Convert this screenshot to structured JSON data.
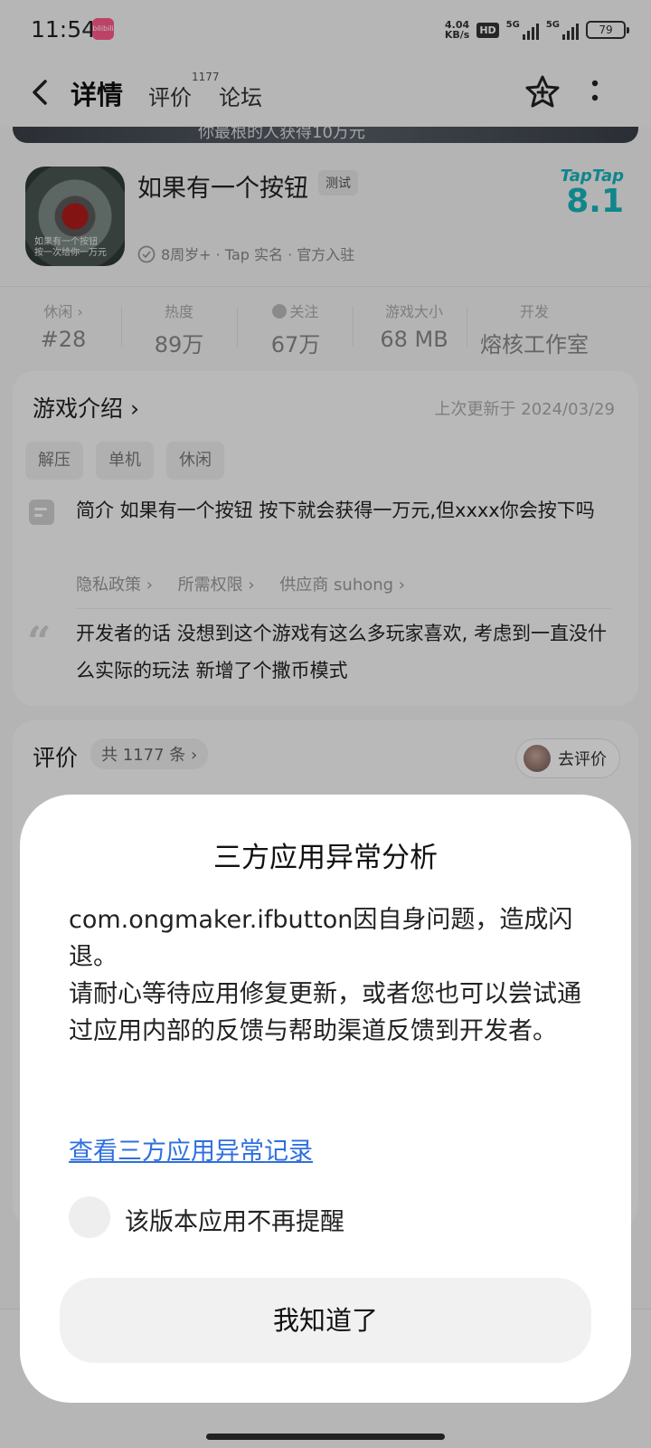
{
  "status_bar": {
    "time": "11:54",
    "app_badge": "bilibili",
    "net_speed_value": "4.04",
    "net_speed_unit": "KB/s",
    "hd": "HD",
    "signal1": "5G",
    "signal2": "5G",
    "battery": "79"
  },
  "header": {
    "tab_details": "详情",
    "tab_reviews": "评价",
    "review_count_sup": "1177",
    "tab_forum": "论坛"
  },
  "banner": {
    "text": "你最根的人获得10万元"
  },
  "game": {
    "title": "如果有一个按钮",
    "test_tag": "测试",
    "icon_caption_1": "如果有一个按钮",
    "icon_caption_2": "按一次给你一万元",
    "meta": "8周岁+ · Tap 实名 · 官方入驻",
    "score_brand": "TapTap",
    "score": "8.1"
  },
  "stats": [
    {
      "label": "休闲 ›",
      "value": "#28"
    },
    {
      "label": "热度",
      "value": "89万"
    },
    {
      "label": "关注",
      "value": "67万"
    },
    {
      "label": "游戏大小",
      "value": "68 MB"
    },
    {
      "label": "开发",
      "value": "熔核工作室"
    }
  ],
  "intro": {
    "title": "游戏介绍 ›",
    "updated": "上次更新于 2024/03/29",
    "tags": [
      "解压",
      "单机",
      "休闲"
    ],
    "summary": "简介 如果有一个按钮 按下就会获得一万元,但xxxx你会按下吗",
    "link_privacy": "隐私政策 ›",
    "link_permissions": "所需权限 ›",
    "link_vendor": "供应商 suhong ›",
    "dev_words": "开发者的话 没想到这个游戏有这么多玩家喜欢, 考虑到一直没什么实际的玩法 新增了个撒币模式"
  },
  "reviews": {
    "title": "评价",
    "count": "共 1177 条 ›",
    "write_button": "去评价"
  },
  "dialog": {
    "title": "三方应用异常分析",
    "body_line1": "com.ongmaker.ifbutton因自身问题，造成闪退。",
    "body_line2": "请耐心等待应用修复更新，或者您也可以尝试通过应用内部的反馈与帮助渠道反馈到开发者。",
    "link": "查看三方应用异常记录",
    "checkbox_label": "该版本应用不再提醒",
    "confirm_button": "我知道了"
  },
  "colors": {
    "accent": "#15c5ce",
    "score": "#15b5bd",
    "link": "#2f6fe0"
  }
}
